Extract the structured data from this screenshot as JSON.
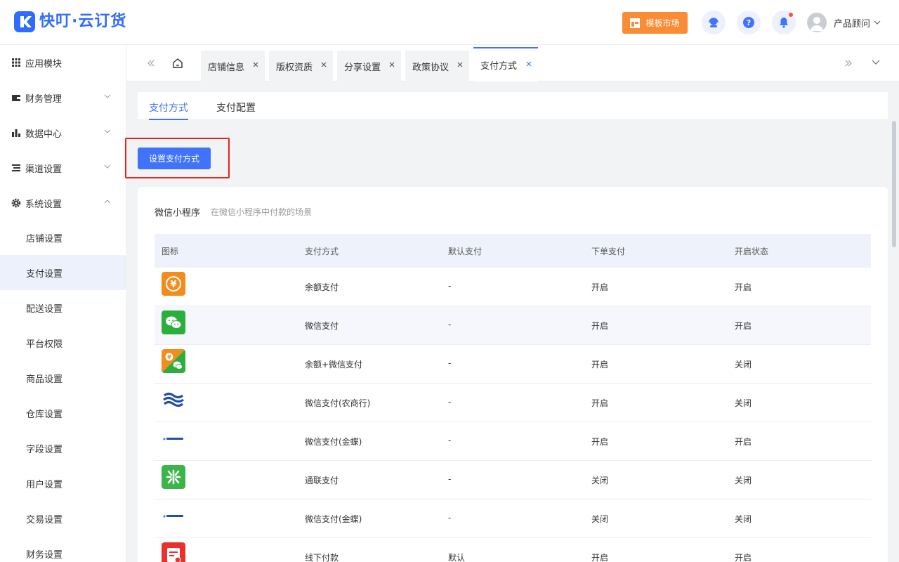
{
  "app": {
    "name": "快叮·云订货"
  },
  "header": {
    "market_label": "模板市场",
    "user_name": "产品顾问"
  },
  "sidebar": {
    "items": [
      {
        "label": "应用模块",
        "icon": "grid-icon"
      },
      {
        "label": "财务管理",
        "icon": "wallet-icon"
      },
      {
        "label": "数据中心",
        "icon": "bar-chart-icon"
      },
      {
        "label": "渠道设置",
        "icon": "list-icon"
      },
      {
        "label": "系统设置",
        "icon": "gear-icon"
      }
    ],
    "sub_items": [
      "店铺设置",
      "支付设置",
      "配送设置",
      "平台权限",
      "商品设置",
      "仓库设置",
      "字段设置",
      "用户设置",
      "交易设置",
      "财务设置"
    ]
  },
  "tabs": [
    {
      "label": "店铺信息"
    },
    {
      "label": "版权资质"
    },
    {
      "label": "分享设置"
    },
    {
      "label": "政策协议"
    },
    {
      "label": "支付方式"
    }
  ],
  "subtabs": [
    "支付方式",
    "支付配置"
  ],
  "main": {
    "set_button": "设置支付方式",
    "section_title": "微信小程序",
    "section_desc": "在微信小程序中付款的场景"
  },
  "table": {
    "columns": [
      "图标",
      "支付方式",
      "默认支付",
      "下单支付",
      "开启状态"
    ],
    "rows": [
      {
        "icon": "balance-pay-icon",
        "name": "余额支付",
        "default": "-",
        "order_pay": "开启",
        "status": "开启"
      },
      {
        "icon": "wechat-pay-icon",
        "name": "微信支付",
        "default": "-",
        "order_pay": "开启",
        "status": "开启"
      },
      {
        "icon": "balance-wechat-icon",
        "name": "余额+微信支付",
        "default": "-",
        "order_pay": "开启",
        "status": "关闭"
      },
      {
        "icon": "abc-bank-icon",
        "name": "微信支付(农商行)",
        "default": "-",
        "order_pay": "开启",
        "status": "关闭"
      },
      {
        "icon": "kingdee-icon",
        "name": "微信支付(金蝶)",
        "default": "-",
        "order_pay": "开启",
        "status": "开启"
      },
      {
        "icon": "allinpay-icon",
        "name": "通联支付",
        "default": "-",
        "order_pay": "关闭",
        "status": "关闭"
      },
      {
        "icon": "kingdee-icon",
        "name": "微信支付(金蝶)",
        "default": "-",
        "order_pay": "关闭",
        "status": "关闭"
      },
      {
        "icon": "offline-pay-icon",
        "name": "线下付款",
        "default": "默认",
        "order_pay": "开启",
        "status": "开启"
      }
    ]
  },
  "colors": {
    "primary": "#4073fa",
    "orange": "#fa8c35",
    "highlight_border": "#e8231e",
    "wechat_green": "#2aae3c"
  }
}
